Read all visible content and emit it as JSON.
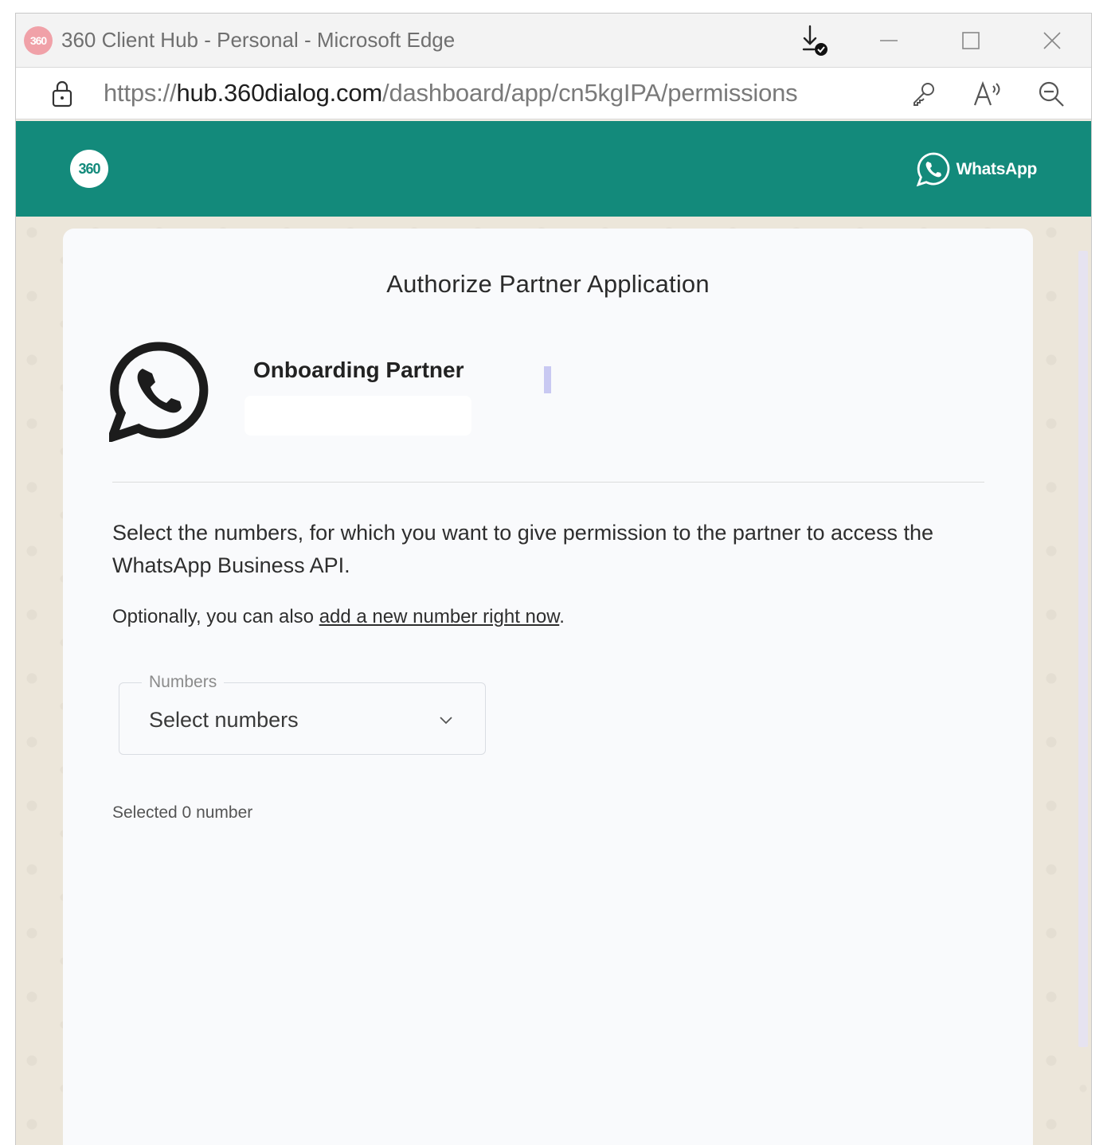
{
  "browser": {
    "window_title": "360 Client Hub - Personal - Microsoft Edge",
    "favicon_text": "360",
    "url_prefix": "https://",
    "url_host": "hub.360dialog.com",
    "url_path": "/dashboard/app/cn5kgIPA/permissions"
  },
  "header": {
    "logo_text": "360",
    "brand_label": "WhatsApp",
    "brand_color": "#138a7b"
  },
  "card": {
    "title": "Authorize Partner Application",
    "partner_name": "Onboarding Partner",
    "description": "Select the numbers, for which you want to give permission to the partner to access the WhatsApp Business API.",
    "optional_prefix": "Optionally, you can also ",
    "optional_link": "add a new number right now",
    "optional_suffix": "."
  },
  "numbers_field": {
    "label": "Numbers",
    "placeholder": "Select numbers"
  },
  "selection_status": "Selected 0 number"
}
